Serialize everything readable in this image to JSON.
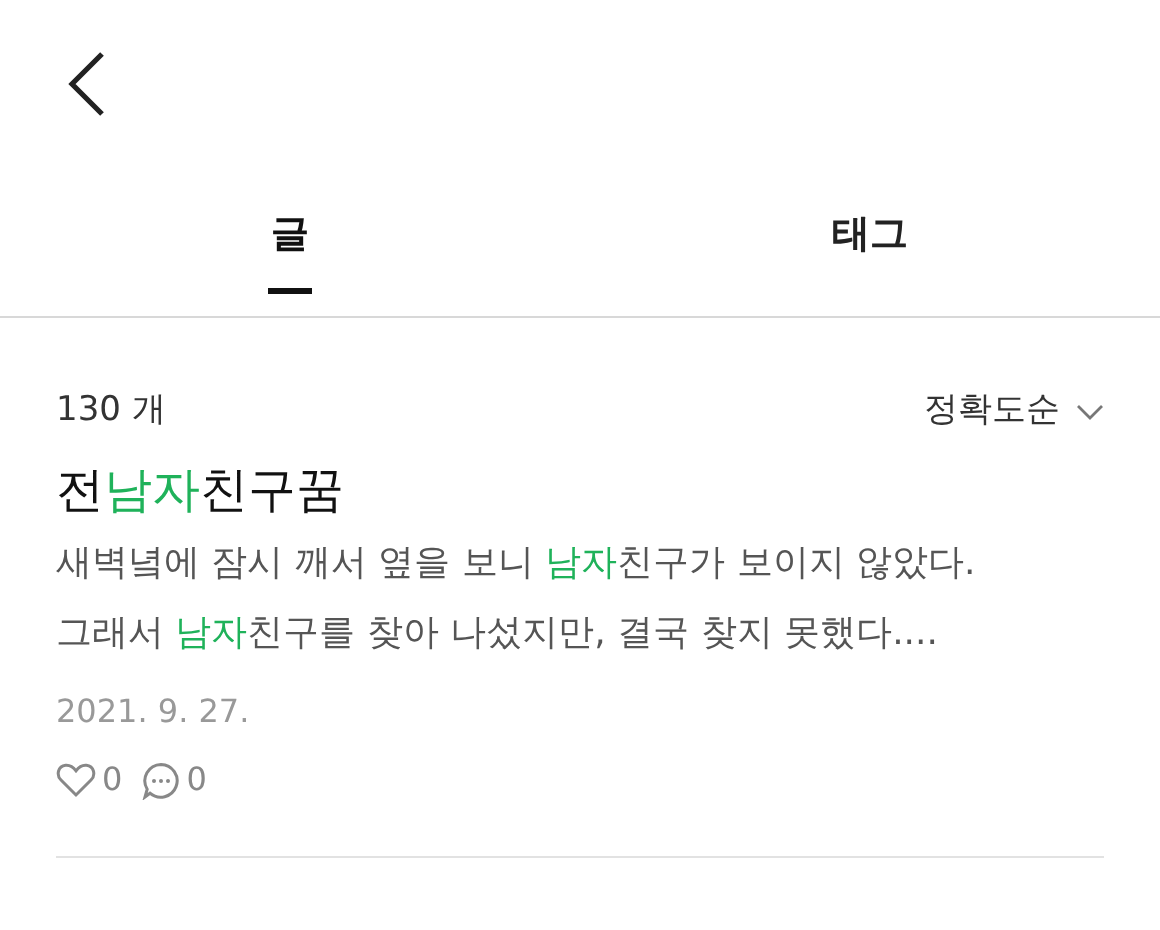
{
  "tabs": [
    {
      "label": "글",
      "selected": true
    },
    {
      "label": "태그",
      "selected": false
    }
  ],
  "result_count": "130 개",
  "sort": {
    "label": "정확도순"
  },
  "posts": [
    {
      "title": [
        {
          "text": "전",
          "highlight": false
        },
        {
          "text": "남자",
          "highlight": true
        },
        {
          "text": "친구꿈",
          "highlight": false
        }
      ],
      "excerpt": [
        {
          "text": "새벽녘에 잠시 깨서 옆을 보니 ",
          "highlight": false
        },
        {
          "text": "남자",
          "highlight": true
        },
        {
          "text": "친구가 보이지 않았다. 그래서 ",
          "highlight": false
        },
        {
          "text": "남자",
          "highlight": true
        },
        {
          "text": "친구를 찾아 나섰지만, 결국 찾지 못했다....",
          "highlight": false
        }
      ],
      "date": "2021. 9. 27.",
      "likes": "0",
      "comments": "0"
    }
  ]
}
